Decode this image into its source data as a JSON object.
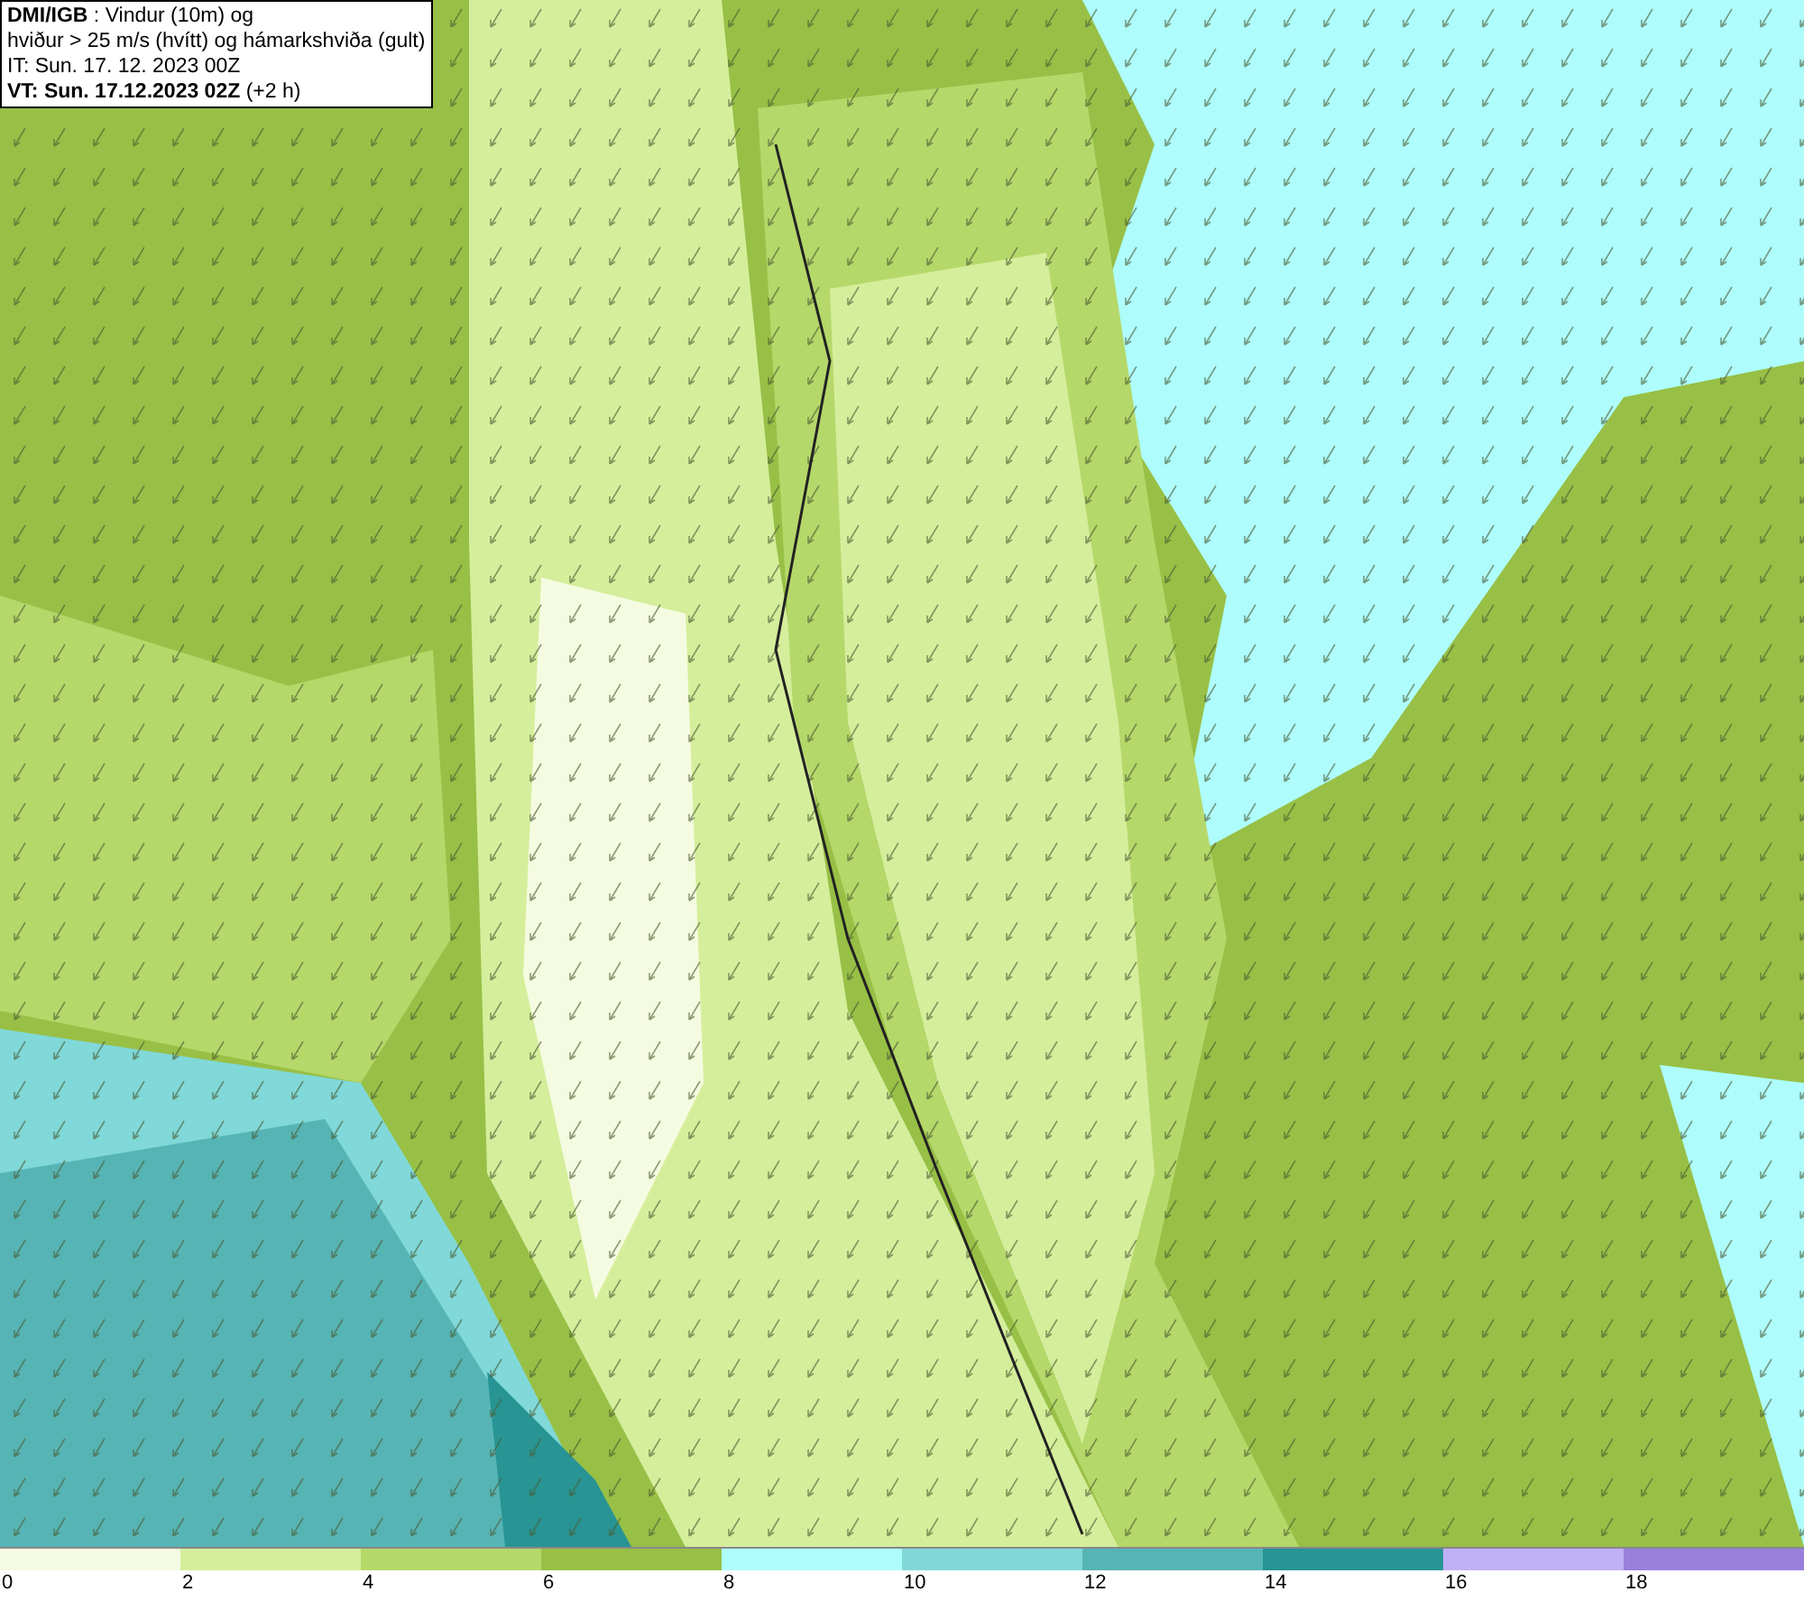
{
  "header": {
    "lines": [
      "**DMI/IGB** : Vindur (10m) og",
      "hviður > 25 m/s (hvítt) og hámarkshviða (gult)",
      "IT: Sun. 17. 12. 2023 00Z",
      "**VT: Sun. 17.12.2023 02Z** (+2 h)"
    ]
  },
  "legend": [
    {
      "label": "0",
      "color": "#f5fbe0"
    },
    {
      "label": "2",
      "color": "#d5ee9c"
    },
    {
      "label": "4",
      "color": "#b5d86a"
    },
    {
      "label": "6",
      "color": "#98c046"
    },
    {
      "label": "8",
      "color": "#aefcfc"
    },
    {
      "label": "10",
      "color": "#80d8d8"
    },
    {
      "label": "12",
      "color": "#56b4b4"
    },
    {
      "label": "14",
      "color": "#289494"
    },
    {
      "label": "16",
      "color": "#c0b0f4"
    },
    {
      "label": "18",
      "color": "#9a80dc"
    }
  ]
}
